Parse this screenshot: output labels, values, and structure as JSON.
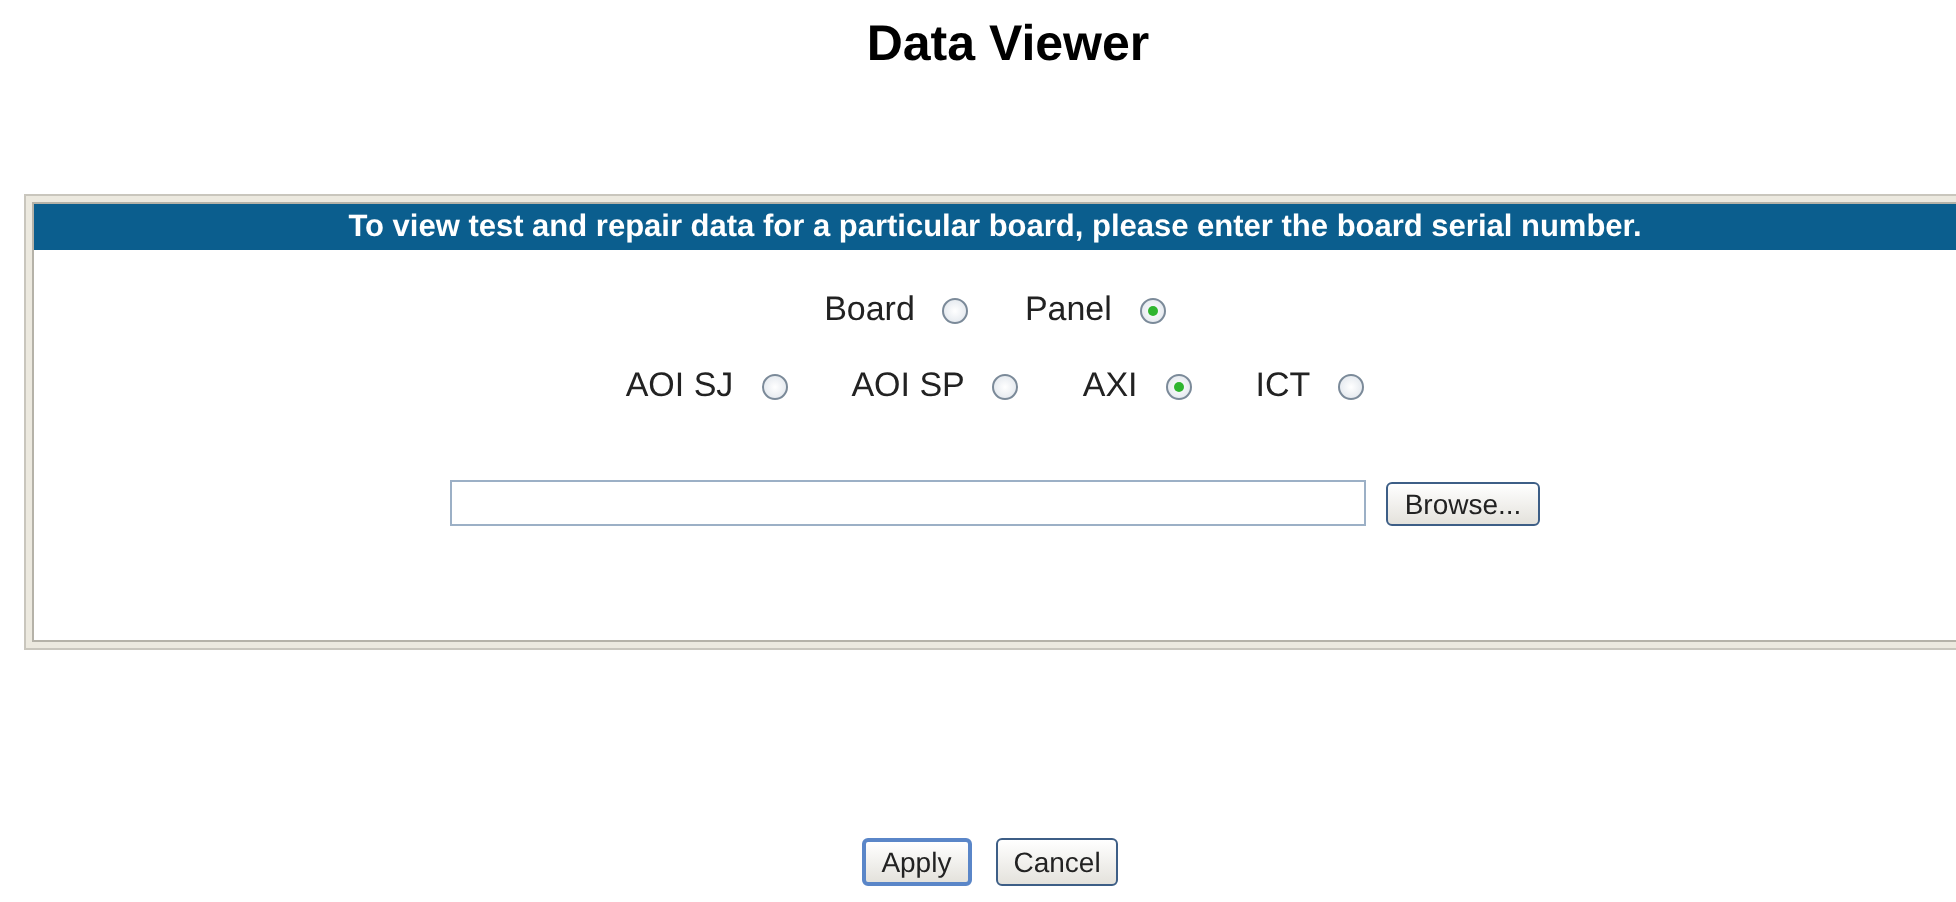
{
  "title": "Data Viewer",
  "panel": {
    "header": "To view test and repair data for a particular board, please enter the board serial number.",
    "scope_options": [
      {
        "label": "Board",
        "selected": false
      },
      {
        "label": "Panel",
        "selected": true
      }
    ],
    "source_options": [
      {
        "label": "AOI SJ",
        "selected": false
      },
      {
        "label": "AOI SP",
        "selected": false
      },
      {
        "label": "AXI",
        "selected": true
      },
      {
        "label": "ICT",
        "selected": false
      }
    ],
    "file_field": {
      "browse_button": "Browse..."
    }
  },
  "buttons": [
    "Apply",
    "Cancel"
  ]
}
